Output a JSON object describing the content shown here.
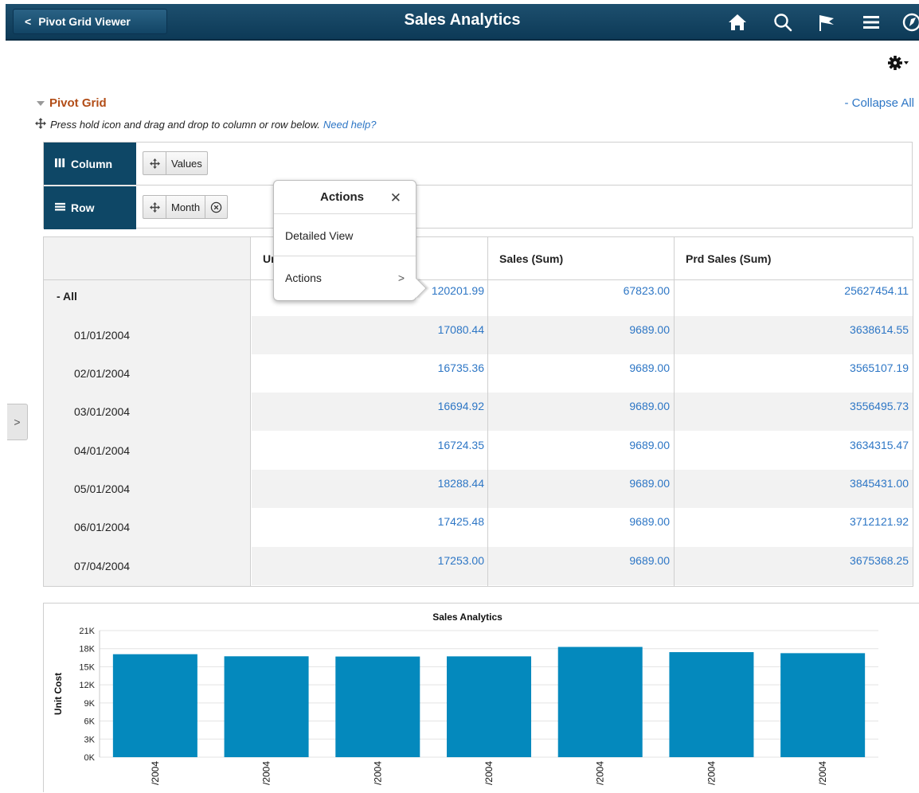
{
  "header": {
    "back_label": "Pivot Grid Viewer",
    "title": "Sales Analytics"
  },
  "pivot": {
    "title": "Pivot Grid",
    "collapse_all": "- Collapse All",
    "hint": "Press hold icon and drag and drop to column or row below.",
    "help_link": "Need help?",
    "column_label": "Column",
    "row_label": "Row",
    "column_chip": "Values",
    "row_chip": "Month"
  },
  "grid": {
    "headers": [
      "Unit Cost",
      "Sales (Sum)",
      "Prd Sales (Sum)"
    ],
    "header_visible_prefix": "Ur",
    "rows": [
      {
        "label": "- All",
        "values": [
          "120201.99",
          "67823.00",
          "25627454.11"
        ]
      },
      {
        "label": "01/01/2004",
        "values": [
          "17080.44",
          "9689.00",
          "3638614.55"
        ]
      },
      {
        "label": "02/01/2004",
        "values": [
          "16735.36",
          "9689.00",
          "3565107.19"
        ]
      },
      {
        "label": "03/01/2004",
        "values": [
          "16694.92",
          "9689.00",
          "3556495.73"
        ]
      },
      {
        "label": "04/01/2004",
        "values": [
          "16724.35",
          "9689.00",
          "3634315.47"
        ]
      },
      {
        "label": "05/01/2004",
        "values": [
          "18288.44",
          "9689.00",
          "3845431.00"
        ]
      },
      {
        "label": "06/01/2004",
        "values": [
          "17425.48",
          "9689.00",
          "3712121.92"
        ]
      },
      {
        "label": "07/04/2004",
        "values": [
          "17253.00",
          "9689.00",
          "3675368.25"
        ]
      }
    ]
  },
  "popup": {
    "title": "Actions",
    "items": [
      "Detailed View",
      "Actions"
    ]
  },
  "colors": {
    "header_bg": "#0d3a57",
    "accent_blue": "#2d76c5",
    "pivot_title": "#b24d17",
    "bar": "#0489bd"
  },
  "chart_data": {
    "type": "bar",
    "title": "Sales Analytics",
    "ylabel": "Unit Cost",
    "xlabel": "",
    "categories": [
      "/2004",
      "/2004",
      "/2004",
      "/2004",
      "/2004",
      "/2004",
      "/2004"
    ],
    "values": [
      17080.44,
      16735.36,
      16694.92,
      16724.35,
      18288.44,
      17425.48,
      17253.0
    ],
    "ylim": [
      0,
      21000
    ],
    "yticks": [
      "0K",
      "3K",
      "6K",
      "9K",
      "12K",
      "15K",
      "18K",
      "21K"
    ],
    "grid": true
  }
}
